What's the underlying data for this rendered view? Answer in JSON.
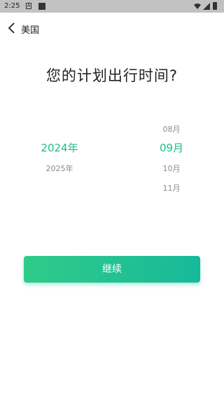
{
  "status_bar": {
    "time": "2:25",
    "notification_icon_letter": "A"
  },
  "header": {
    "title": "美国"
  },
  "question": "您的计划出行时间?",
  "picker": {
    "years": [
      "2024年",
      "2025年"
    ],
    "selected_year": "2024年",
    "months": [
      "08月",
      "09月",
      "10月",
      "11月"
    ],
    "selected_month": "09月"
  },
  "continue_label": "继续",
  "colors": {
    "accent": "#1fbb8c",
    "button_start": "#2fcb89",
    "button_end": "#17b99a"
  }
}
